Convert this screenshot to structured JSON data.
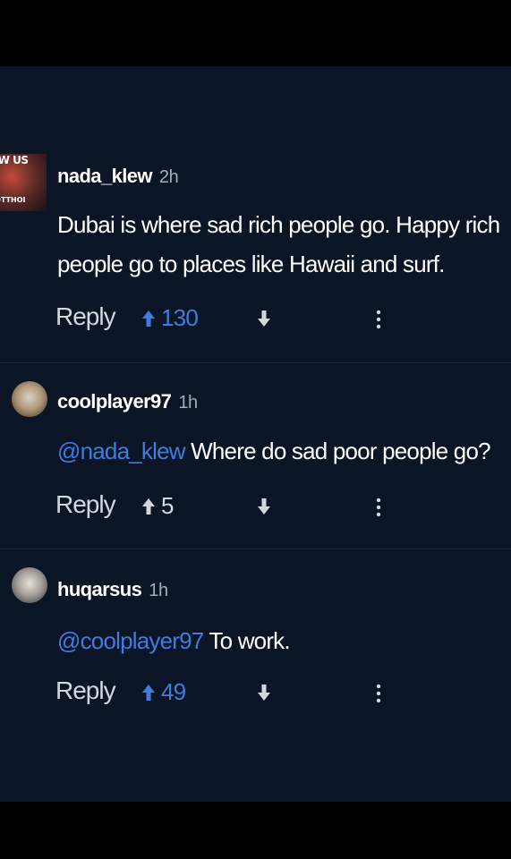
{
  "comments": [
    {
      "username": "nada_klew",
      "time": "2h",
      "avatar_text_top": "OW US",
      "avatar_text_bottom": "ROTTHOI",
      "mention": "",
      "text_line1": "Dubai is where sad rich people go. Happy rich",
      "text_line2": "people go to places like Hawaii and surf.",
      "reply_label": "Reply",
      "score": "130",
      "score_highlighted": true
    },
    {
      "username": "coolplayer97",
      "time": "1h",
      "mention": "@nada_klew",
      "text": "Where do sad poor people go?",
      "reply_label": "Reply",
      "score": "5",
      "score_highlighted": false
    },
    {
      "username": "huqarsus",
      "time": "1h",
      "mention": "@coolplayer97",
      "text": "To work.",
      "reply_label": "Reply",
      "score": "49",
      "score_highlighted": true
    }
  ],
  "icons": {
    "upvote": "arrow-up-icon",
    "downvote": "arrow-down-icon",
    "more": "more-vertical-icon"
  },
  "colors": {
    "background": "#0c1526",
    "accent_blue": "#3d7de0",
    "text_white": "#ffffff",
    "text_muted": "#a5acb8"
  }
}
